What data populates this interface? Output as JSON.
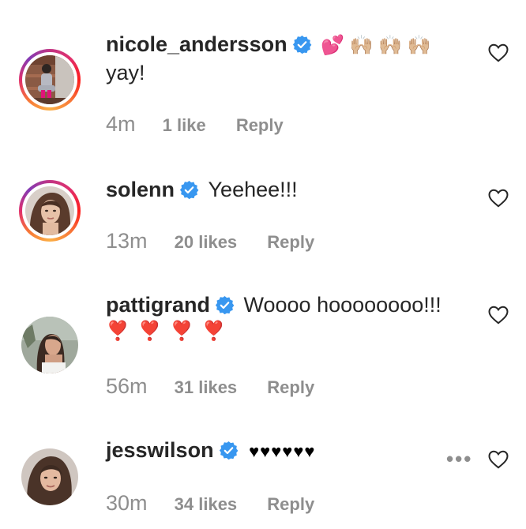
{
  "comments": [
    {
      "username": "nicole_andersson",
      "emojis": "💕 🙌🏼 🙌🏼 🙌🏼",
      "message": "yay!",
      "time": "4m",
      "likes": "1 like",
      "reply": "Reply",
      "story_ring": true
    },
    {
      "username": "solenn",
      "message": "Yeehee!!!",
      "time": "13m",
      "likes": "20 likes",
      "reply": "Reply",
      "story_ring": true
    },
    {
      "username": "pattigrand",
      "message": "Woooo hoooooooo!!!",
      "emojis": "❣️ ❣️ ❣️ ❣️",
      "time": "56m",
      "likes": "31 likes",
      "reply": "Reply",
      "story_ring": false
    },
    {
      "username": "jesswilson",
      "message": "♥♥♥♥♥♥",
      "time": "30m",
      "likes": "34 likes",
      "reply": "Reply",
      "story_ring": false
    }
  ],
  "colors": {
    "text": "#262626",
    "meta": "#8e8e8e",
    "verified": "#3897f0"
  },
  "icons": [
    "verified-badge-icon",
    "heart-outline-icon",
    "more-options-icon"
  ]
}
